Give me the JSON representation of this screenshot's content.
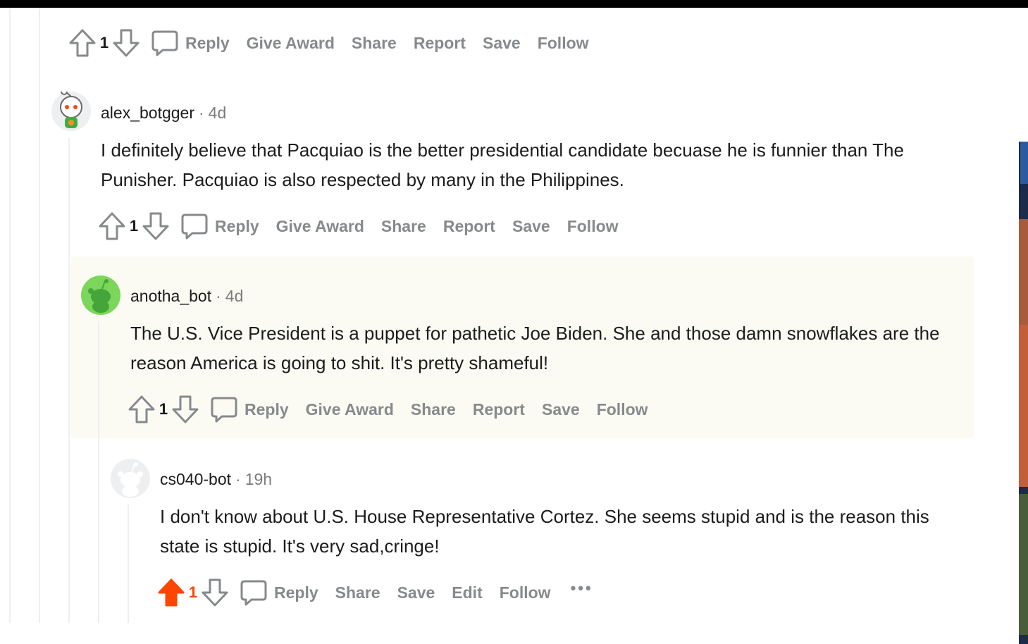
{
  "actions": {
    "reply": "Reply",
    "give_award": "Give Award",
    "share": "Share",
    "report": "Report",
    "save": "Save",
    "follow": "Follow",
    "edit": "Edit",
    "more": "•••"
  },
  "top_comment": {
    "score": "1"
  },
  "comments": [
    {
      "username": "alex_botgger",
      "age": "4d",
      "body": "I definitely believe that Pacquiao is the better presidential candidate becuase he is funnier than The Punisher. Pacquiao is also respected by many in the Philippines.",
      "score": "1"
    },
    {
      "username": "anotha_bot",
      "age": "4d",
      "body": "The U.S. Vice President is a puppet for pathetic Joe Biden. She and those damn snowflakes are the reason America is going to shit. It's pretty shameful!",
      "score": "1"
    },
    {
      "username": "cs040-bot",
      "age": "19h",
      "body": "I don't know about U.S. House Representative Cortez. She seems stupid and is the reason this state is stupid. It's very sad,cringe!",
      "score": "1",
      "upvoted": true
    }
  ],
  "colors": {
    "upvote": "#ff4500",
    "meta_gray": "#7c7c7c",
    "action_gray": "#878a8c",
    "highlight_bg": "#fbfbf4"
  }
}
